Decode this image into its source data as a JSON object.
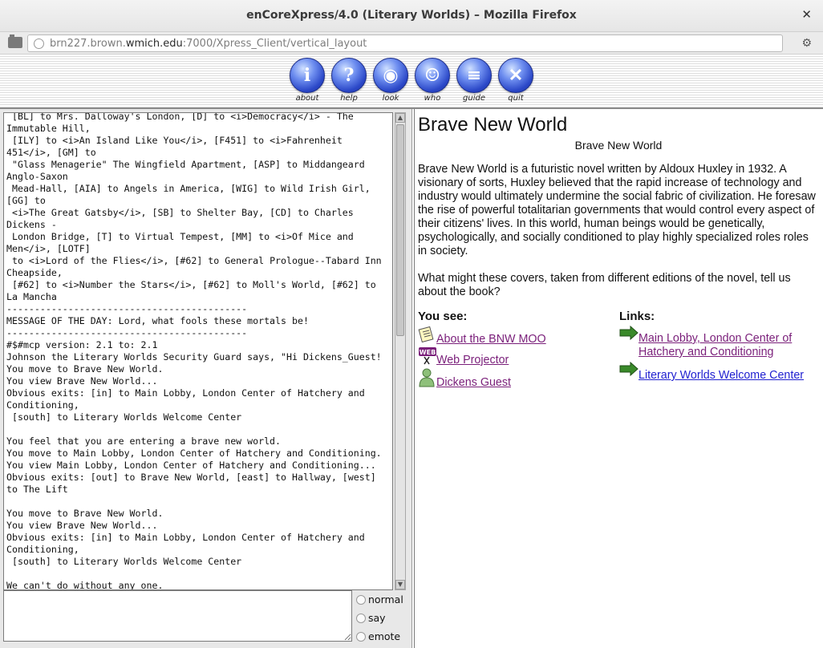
{
  "window": {
    "title": "enCoreXpress/4.0 (Literary Worlds) – Mozilla Firefox",
    "close_glyph": "✕"
  },
  "navbar": {
    "url_prefix": "brn227.brown.",
    "url_domain": "wmich.edu",
    "url_suffix": ":7000/Xpress_Client/vertical_layout"
  },
  "toolbar": {
    "buttons": [
      {
        "label": "about",
        "glyph": "i",
        "icon": "info-icon"
      },
      {
        "label": "help",
        "glyph": "?",
        "icon": "help-icon"
      },
      {
        "label": "look",
        "glyph": "◉",
        "icon": "eye-icon"
      },
      {
        "label": "who",
        "glyph": "☺",
        "icon": "person-icon"
      },
      {
        "label": "guide",
        "glyph": "≡",
        "icon": "book-icon"
      },
      {
        "label": "quit",
        "glyph": "✕",
        "icon": "close-icon"
      }
    ]
  },
  "output": {
    "text": " [BL] to Mrs. Dalloway's London, [D] to <i>Democracy</i> - The\nImmutable Hill,\n [ILY] to <i>An Island Like You</i>, [F451] to <i>Fahrenheit\n451</i>, [GM] to\n \"Glass Menagerie\" The Wingfield Apartment, [ASP] to Middangeard\nAnglo-Saxon\n Mead-Hall, [AIA] to Angels in America, [WIG] to Wild Irish Girl,\n[GG] to\n <i>The Great Gatsby</i>, [SB] to Shelter Bay, [CD] to Charles\nDickens -\n London Bridge, [T] to Virtual Tempest, [MM] to <i>Of Mice and\nMen</i>, [LOTF]\n to <i>Lord of the Flies</i>, [#62] to General Prologue--Tabard Inn\nCheapside,\n [#62] to <i>Number the Stars</i>, [#62] to Moll's World, [#62] to\nLa Mancha\n-------------------------------------------\nMESSAGE OF THE DAY: Lord, what fools these mortals be!\n-------------------------------------------\n#$#mcp version: 2.1 to: 2.1\nJohnson the Literary Worlds Security Guard says, \"Hi Dickens_Guest!\nYou move to Brave New World.\nYou view Brave New World...\nObvious exits: [in] to Main Lobby, London Center of Hatchery and\nConditioning,\n [south] to Literary Worlds Welcome Center\n\nYou feel that you are entering a brave new world.\nYou move to Main Lobby, London Center of Hatchery and Conditioning.\nYou view Main Lobby, London Center of Hatchery and Conditioning...\nObvious exits: [out] to Brave New World, [east] to Hallway, [west]\nto The Lift\n\nYou move to Brave New World.\nYou view Brave New World...\nObvious exits: [in] to Main Lobby, London Center of Hatchery and\nConditioning,\n [south] to Literary Worlds Welcome Center\n\nWe can't do without any one."
  },
  "input_modes": [
    "normal",
    "say",
    "emote"
  ],
  "room": {
    "title": "Brave New World",
    "subtitle": "Brave New World",
    "description": "Brave New World is a futuristic novel written by Aldoux Huxley in 1932. A visionary of sorts, Huxley believed that the rapid increase of technology and industry would ultimately undermine the social fabric of civilization. He foresaw the rise of powerful totalitarian governments that would control every aspect of their citizens' lives. In this world, human beings would be genetically, psychologically, and socially conditioned to play highly specialized roles roles in society.",
    "question": "What might these covers, taken from different editions of the novel, tell us about the book?",
    "you_see_heading": "You see:",
    "links_heading": "Links:",
    "you_see": [
      {
        "label": "About the BNW MOO",
        "icon": "note-icon"
      },
      {
        "label": "Web Projector",
        "icon": "web-projector-icon"
      },
      {
        "label": "Dickens Guest",
        "icon": "person-icon"
      }
    ],
    "links": [
      {
        "label": "Main Lobby, London Center of Hatchery and Conditioning",
        "icon": "arrow-right-icon"
      },
      {
        "label": "Literary Worlds Welcome Center",
        "icon": "arrow-right-icon"
      }
    ]
  },
  "colors": {
    "visited_link": "#7a1f7a",
    "link": "#1f1fd0",
    "toolbar_orb": "#2b48c8"
  }
}
